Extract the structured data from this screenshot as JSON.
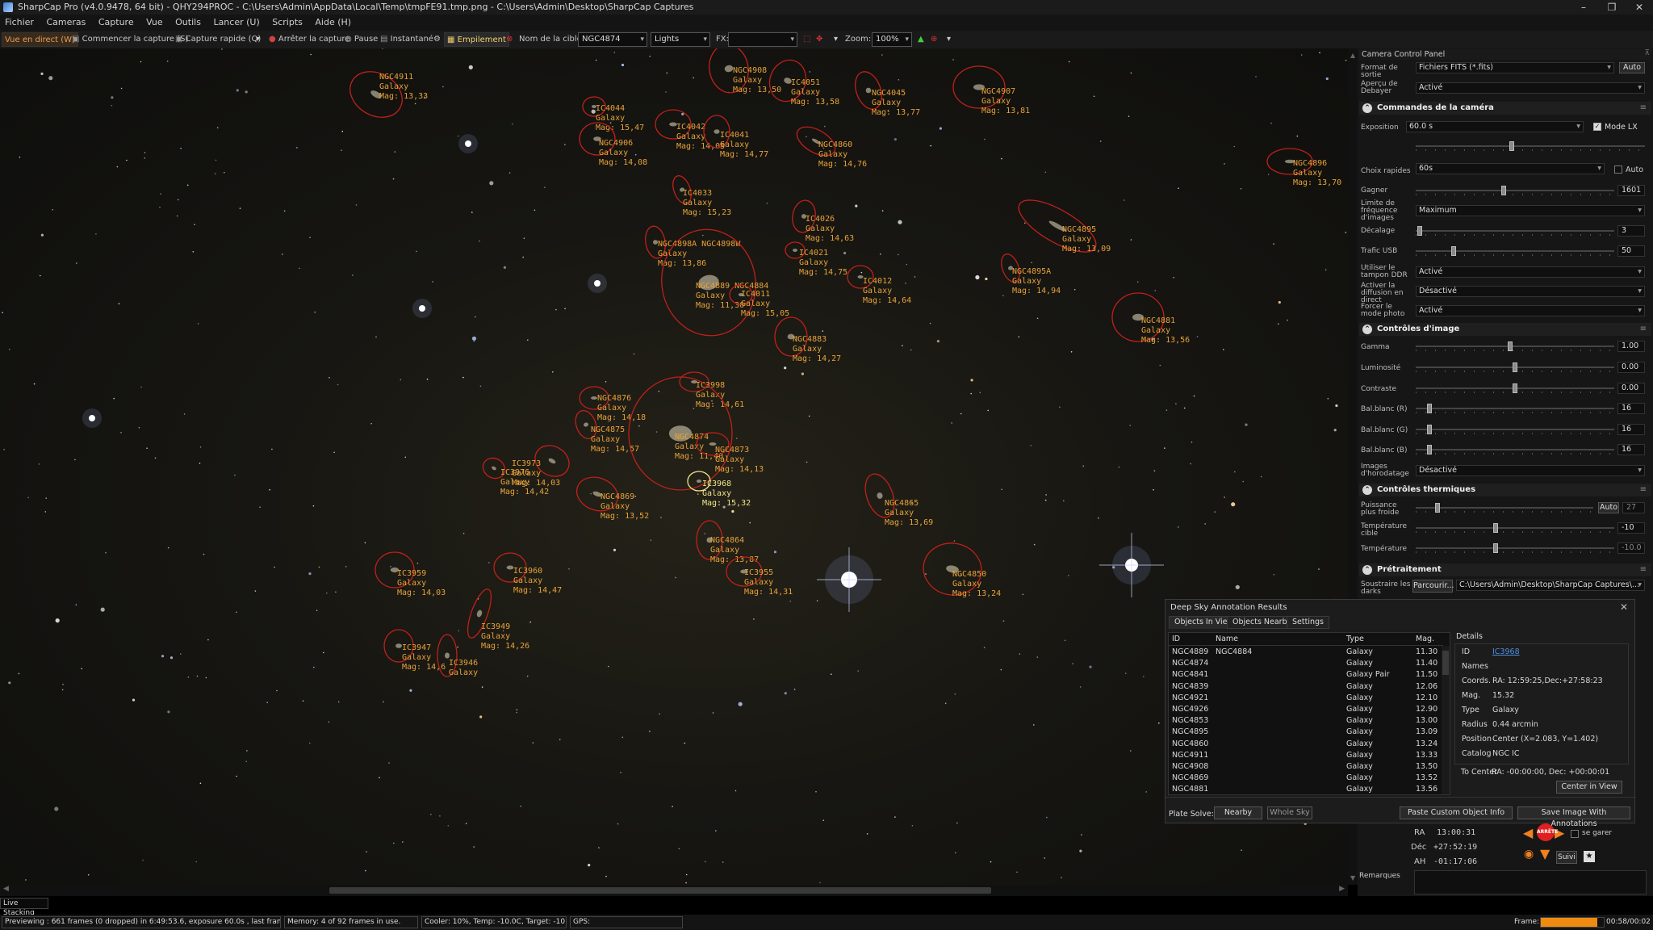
{
  "window": {
    "title": "SharpCap Pro (v4.0.9478, 64 bit) - QHY294PROC - C:\\Users\\Admin\\AppData\\Local\\Temp\\tmpFE91.tmp.png - C:\\Users\\Admin\\Desktop\\SharpCap Captures",
    "minimize": "–",
    "maximize": "❐",
    "close": "✕"
  },
  "menu": [
    "Fichier",
    "Cameras",
    "Capture",
    "Vue",
    "Outils",
    "Lancer (U)",
    "Scripts",
    "Aide (H)"
  ],
  "toolbar": {
    "live_view": "Vue en direct (W)",
    "start_capture": "Commencer la capture (S)",
    "quick_capture": "Capture rapide (Q)",
    "stop_capture": "Arrêter la capture",
    "pause": "Pause",
    "snapshot": "Instantané",
    "stacking": "Empilement",
    "target_label": "Nom de la cible:",
    "target_value": "NGC4874",
    "frame_type": "Lights",
    "fx_label": "FX:",
    "fx_value": "",
    "zoom_label": "Zoom:",
    "zoom_value": "100%"
  },
  "sky_objects": [
    {
      "id": "NGC4911",
      "type": "Galaxy",
      "mag": "Mag: 13,33"
    },
    {
      "id": "NGC4908",
      "type": "Galaxy",
      "mag": "Mag: 13,50"
    },
    {
      "id": "IC4051",
      "type": "Galaxy",
      "mag": "Mag: 13,58"
    },
    {
      "id": "NGC4045",
      "type": "Galaxy",
      "mag": "Mag: 13,77"
    },
    {
      "id": "NGC4907",
      "type": "Galaxy",
      "mag": "Mag: 13,81"
    },
    {
      "id": "IC4044",
      "type": "Galaxy",
      "mag": "Mag: 15,47"
    },
    {
      "id": "IC4042",
      "type": "Galaxy",
      "mag": "Mag: 14,05"
    },
    {
      "id": "IC4041",
      "type": "Galaxy",
      "mag": "Mag: 14,77"
    },
    {
      "id": "NGC4906",
      "type": "Galaxy",
      "mag": "Mag: 14,08"
    },
    {
      "id": "NGC4860",
      "type": "Galaxy",
      "mag": "Mag: 14,76"
    },
    {
      "id": "NGC4896",
      "type": "Galaxy",
      "mag": "Mag: 13,70"
    },
    {
      "id": "IC4033",
      "type": "Galaxy",
      "mag": "Mag: 15,23"
    },
    {
      "id": "IC4026",
      "type": "Galaxy",
      "mag": "Mag: 14,63"
    },
    {
      "id": "NGC4895",
      "type": "Galaxy",
      "mag": "Mag: 13,09"
    },
    {
      "id": "NGC4898A NGC4898W",
      "type": "Galaxy",
      "mag": "Mag: 13,86"
    },
    {
      "id": "IC4021",
      "type": "Galaxy",
      "mag": "Mag: 14,75"
    },
    {
      "id": "NGC4895A",
      "type": "Galaxy",
      "mag": "Mag: 14,94"
    },
    {
      "id": "IC4012",
      "type": "Galaxy",
      "mag": "Mag: 14,64"
    },
    {
      "id": "NGC4889 NGC4884",
      "type": "Galaxy",
      "mag": "Mag: 11,30"
    },
    {
      "id": "IC4011",
      "type": "Galaxy",
      "mag": "Mag: 15,05"
    },
    {
      "id": "NGC4881",
      "type": "Galaxy",
      "mag": "Mag: 13,56"
    },
    {
      "id": "NGC4883",
      "type": "Galaxy",
      "mag": "Mag: 14,27"
    },
    {
      "id": "IC3998",
      "type": "Galaxy",
      "mag": "Mag: 14,61"
    },
    {
      "id": "NGC4876",
      "type": "Galaxy",
      "mag": "Mag: 14,18"
    },
    {
      "id": "NGC4875",
      "type": "Galaxy",
      "mag": "Mag: 14,57"
    },
    {
      "id": "NGC4874",
      "type": "Galaxy",
      "mag": "Mag: 11,40"
    },
    {
      "id": "NGC4873",
      "type": "Galaxy",
      "mag": "Mag: 14,13"
    },
    {
      "id": "IC3973",
      "type": "Galaxy",
      "mag": "Mag: 14,03"
    },
    {
      "id": "IC3976",
      "type": "Galaxy",
      "mag": "Mag: 14,42"
    },
    {
      "id": "IC3968",
      "type": "Galaxy",
      "mag": "Mag: 15,32"
    },
    {
      "id": "NGC4869",
      "type": "Galaxy",
      "mag": "Mag: 13,52"
    },
    {
      "id": "NGC4865",
      "type": "Galaxy",
      "mag": "Mag: 13,69"
    },
    {
      "id": "NGC4864",
      "type": "Galaxy",
      "mag": "Mag: 13,87"
    },
    {
      "id": "IC3959",
      "type": "Galaxy",
      "mag": "Mag: 14,03"
    },
    {
      "id": "IC3960",
      "type": "Galaxy",
      "mag": "Mag: 14,47"
    },
    {
      "id": "IC3955",
      "type": "Galaxy",
      "mag": "Mag: 14,31"
    },
    {
      "id": "NGC4850",
      "type": "Galaxy",
      "mag": "Mag: 13,24"
    },
    {
      "id": "IC3949",
      "type": "Galaxy",
      "mag": "Mag: 14,26"
    },
    {
      "id": "IC3947",
      "type": "Galaxy",
      "mag": "Mag: 14,6"
    },
    {
      "id": "IC3946",
      "type": "Galaxy",
      "mag": ""
    }
  ],
  "ccp": {
    "title": "Camera Control Panel",
    "output_format_label": "Format de sortie",
    "output_format_value": "Fichiers FITS (*.fits)",
    "output_auto": "Auto",
    "debayer_label": "Aperçu de Debayer",
    "debayer_value": "Activé",
    "sec_camera": "Commandes de la caméra",
    "exposure_label": "Exposition",
    "exposure_value": "60.0 s",
    "lx_mode": "Mode LX",
    "quick_choice_label": "Choix rapides",
    "quick_choice_value": "60s",
    "quick_auto": "Auto",
    "gain_label": "Gagner",
    "gain_value": "1601",
    "framerate_label": "Limite de fréquence d'images",
    "framerate_value": "Maximum",
    "offset_label": "Décalage",
    "offset_value": "3",
    "usb_label": "Trafic USB",
    "usb_value": "50",
    "ddr_label": "Utiliser le tampon DDR",
    "ddr_value": "Activé",
    "live_diff_label": "Activer la diffusion en direct",
    "live_diff_value": "Désactivé",
    "force_photo_label": "Forcer le mode photo",
    "force_photo_value": "Activé",
    "sec_image": "Contrôles d'image",
    "gamma_label": "Gamma",
    "gamma_value": "1.00",
    "lum_label": "Luminosité",
    "lum_value": "0.00",
    "contrast_label": "Contraste",
    "contrast_value": "0.00",
    "wbr_label": "Bal.blanc (R)",
    "wbr_value": "16",
    "wbg_label": "Bal.blanc (G)",
    "wbg_value": "16",
    "wbb_label": "Bal.blanc (B)",
    "wbb_value": "16",
    "timestamp_label": "Images d'horodatage",
    "timestamp_value": "Désactivé",
    "sec_thermal": "Contrôles thermiques",
    "cooler_power_label": "Puissance plus froide",
    "cooler_auto": "Auto",
    "cooler_power_value": "27",
    "target_temp_label": "Température cible",
    "target_temp_value": "-10",
    "temp_label": "Température",
    "temp_value": "-10.0",
    "sec_preproc": "Prétraitement",
    "darks_label": "Soustraire les darks",
    "darks_browse": "Parcourir...",
    "darks_value": "C:\\Users\\Admin\\Desktop\\SharpCap Captures\\..."
  },
  "dsa": {
    "title": "Deep Sky Annotation Results",
    "tabs": [
      "Objects In View",
      "Objects Nearby",
      "Settings"
    ],
    "headers": [
      "ID",
      "Name",
      "Type",
      "Mag."
    ],
    "rows": [
      [
        "NGC4889",
        "NGC4884",
        "Galaxy",
        "11.30"
      ],
      [
        "NGC4874",
        "",
        "Galaxy",
        "11.40"
      ],
      [
        "NGC4841",
        "",
        "Galaxy Pair",
        "11.50"
      ],
      [
        "NGC4839",
        "",
        "Galaxy",
        "12.06"
      ],
      [
        "NGC4921",
        "",
        "Galaxy",
        "12.10"
      ],
      [
        "NGC4926",
        "",
        "Galaxy",
        "12.90"
      ],
      [
        "NGC4853",
        "",
        "Galaxy",
        "13.00"
      ],
      [
        "NGC4895",
        "",
        "Galaxy",
        "13.09"
      ],
      [
        "NGC4860",
        "",
        "Galaxy",
        "13.24"
      ],
      [
        "NGC4911",
        "",
        "Galaxy",
        "13.33"
      ],
      [
        "NGC4908",
        "",
        "Galaxy",
        "13.50"
      ],
      [
        "NGC4869",
        "",
        "Galaxy",
        "13.52"
      ],
      [
        "NGC4881",
        "",
        "Galaxy",
        "13.56"
      ]
    ],
    "details_title": "Details",
    "details": {
      "id_label": "ID",
      "id": "IC3968",
      "names_label": "Names",
      "names": "",
      "coords_label": "Coords.",
      "coords": "RA: 12:59:25,Dec:+27:58:23",
      "mag_label": "Mag.",
      "mag": "15.32",
      "type_label": "Type",
      "type": "Galaxy",
      "radius_label": "Radius",
      "radius": "0.44 arcmin",
      "position_label": "Position",
      "position": "Center (X=2.083, Y=1.402)",
      "catalog_label": "Catalog",
      "catalog": "NGC IC",
      "tocenter_label": "To Center",
      "tocenter": "RA: -00:00:00, Dec: +00:00:01"
    },
    "center_btn": "Center in View",
    "plate_solve_label": "Plate Solve:",
    "nearby_btn": "Nearby",
    "whole_sky_btn": "Whole Sky",
    "paste_btn": "Paste Custom Object Info",
    "save_btn": "Save Image With Annotations"
  },
  "telescope": {
    "ra_label": "RA",
    "ra": "13:00:31",
    "dec_label": "Déc",
    "dec": "+27:52:19",
    "ah_label": "AH",
    "ah": "-01:17:06",
    "stop": "ARRÊTE",
    "park": "se garer",
    "follow": "Suivi",
    "remarks": "Remarques"
  },
  "live_stacking": "Live Stacking",
  "status": {
    "preview": "Previewing : 661 frames (0 dropped) in 6:49:53.6, exposure 60.0s , last frame 60.7s",
    "memory": "Memory: 4 of 92 frames in use.",
    "cooler": "Cooler: 10%, Temp: -10.0C, Target: -10.0C",
    "gps": "GPS:",
    "frame_label": "Frame:",
    "frame_time": "00:58/00:02",
    "frame_progress": 0.9
  }
}
